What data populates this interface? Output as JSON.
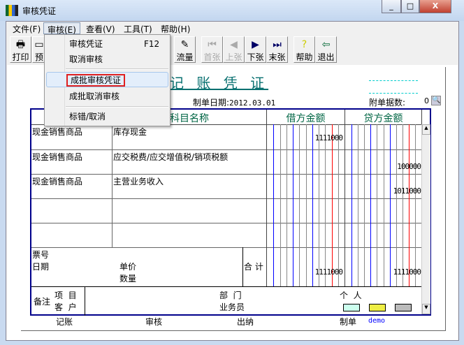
{
  "window": {
    "title": "审核凭证",
    "minimize": "_",
    "maximize": "□",
    "close": "X"
  },
  "menubar": [
    "文件(F)",
    "审核(E)",
    "查看(V)",
    "工具(T)",
    "帮助(H)"
  ],
  "toolbar": {
    "print": "打印",
    "preview": "预",
    "flow": "流量",
    "first": "首张",
    "prev": "上张",
    "next": "下张",
    "last": "末张",
    "help": "帮助",
    "exit": "退出"
  },
  "menu": {
    "items": [
      {
        "label": "审核凭证",
        "shortcut": "F12"
      },
      {
        "label": "取消审核"
      },
      {
        "label": "成批审核凭证"
      },
      {
        "label": "成批取消审核"
      },
      {
        "label": "标错/取消"
      }
    ]
  },
  "voucher": {
    "title": "记 账 凭 证",
    "date_label": "制单日期:",
    "date": "2012.03.01",
    "attach_label": "附单据数:",
    "attach_count": "0",
    "headers": {
      "subject": "科目名称",
      "debit": "借方金额",
      "credit": "贷方金额"
    },
    "rows": [
      {
        "summary": "现金销售商品",
        "subject": "库存现金",
        "debit": "1111000",
        "credit": ""
      },
      {
        "summary": "现金销售商品",
        "subject": "应交税费/应交增值税/销项税额",
        "debit": "",
        "credit": "100000"
      },
      {
        "summary": "现金销售商品",
        "subject": "主营业务收入",
        "debit": "",
        "credit": "1011000"
      }
    ],
    "footer": {
      "ticket": "票号",
      "date": "日期",
      "price": "单价",
      "qty": "数量",
      "total_label": "合 计",
      "total_debit": "1111000",
      "total_credit": "1111000"
    },
    "notes": {
      "label": "备注",
      "project": "项  目",
      "customer": "客  户",
      "dept": "部  门",
      "salesman": "业务员",
      "person": "个  人"
    },
    "signatures": {
      "posting": "记账",
      "audit": "审核",
      "cashier": "出纳",
      "maker": "制单",
      "maker_name": "demo"
    }
  }
}
